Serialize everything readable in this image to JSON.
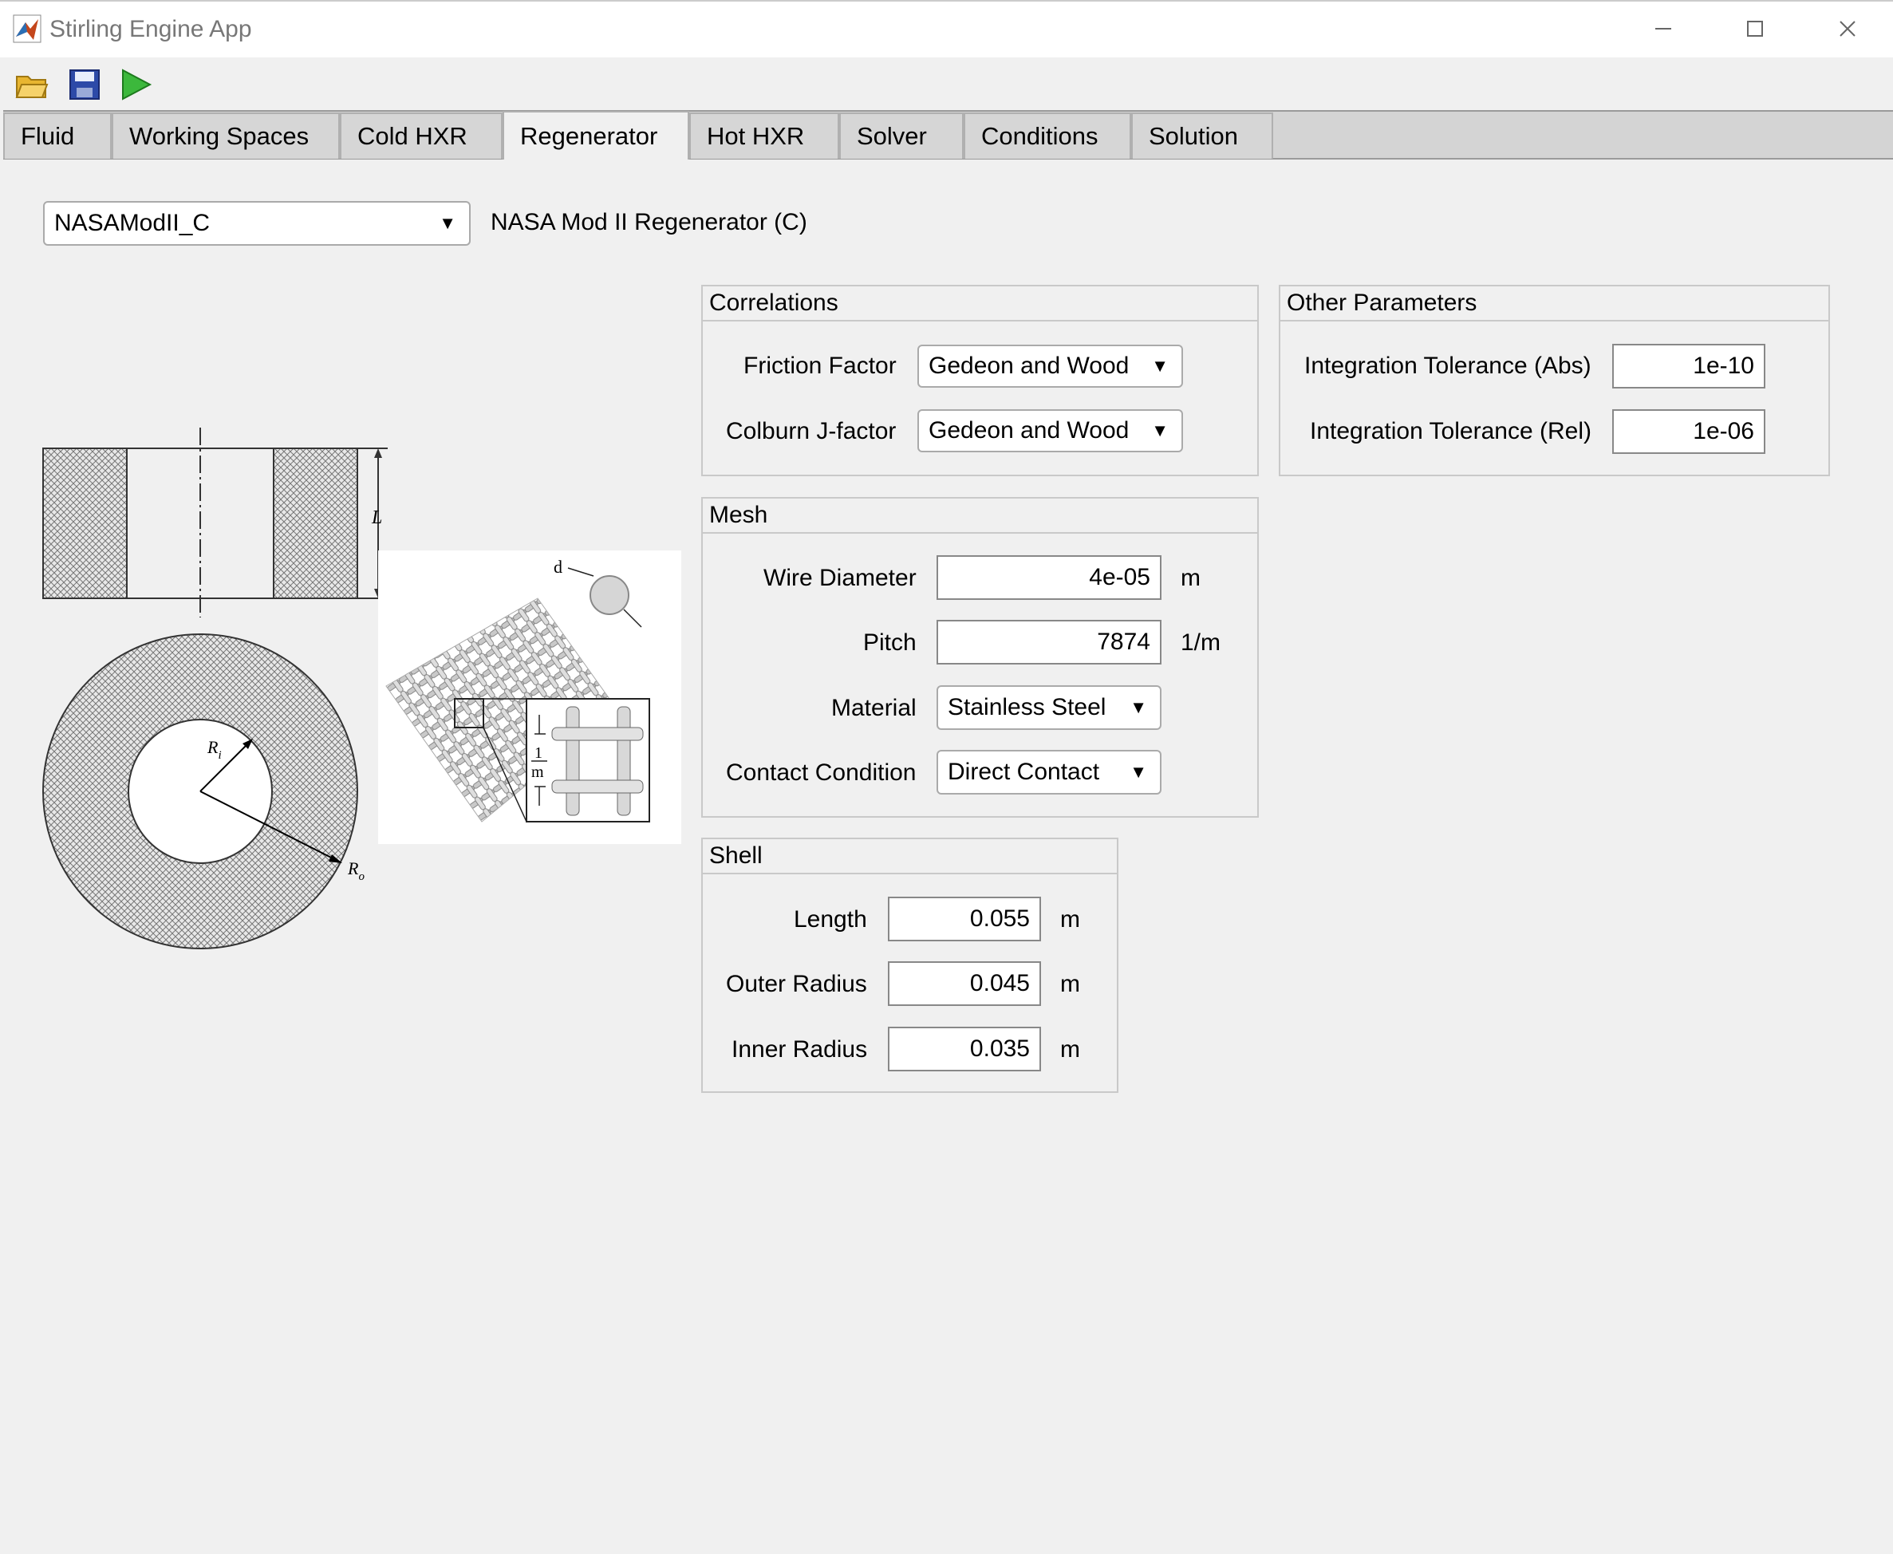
{
  "window": {
    "title": "Stirling Engine App"
  },
  "toolbar": {
    "open_icon": "folder-open-icon",
    "save_icon": "save-icon",
    "run_icon": "play-icon"
  },
  "tabs": [
    "Fluid",
    "Working Spaces",
    "Cold HXR",
    "Regenerator",
    "Hot HXR",
    "Solver",
    "Conditions",
    "Solution"
  ],
  "active_tab": "Regenerator",
  "selector": {
    "value": "NASAModII_C",
    "description": "NASA Mod II Regenerator (C)"
  },
  "diagram": {
    "length_label": "L",
    "inner_radius_label": "R",
    "inner_radius_sub": "i",
    "outer_radius_label": "R",
    "outer_radius_sub": "o",
    "mesh_d_label": "d",
    "mesh_pitch_num": "1",
    "mesh_pitch_den": "m"
  },
  "correlations": {
    "title": "Correlations",
    "friction_label": "Friction Factor",
    "friction_value": "Gedeon and Wood",
    "colburn_label": "Colburn J-factor",
    "colburn_value": "Gedeon and Wood"
  },
  "other": {
    "title": "Other Parameters",
    "abs_label": "Integration Tolerance (Abs)",
    "abs_value": "1e-10",
    "rel_label": "Integration Tolerance (Rel)",
    "rel_value": "1e-06"
  },
  "mesh": {
    "title": "Mesh",
    "wire_label": "Wire Diameter",
    "wire_value": "4e-05",
    "wire_unit": "m",
    "pitch_label": "Pitch",
    "pitch_value": "7874",
    "pitch_unit": "1/m",
    "material_label": "Material",
    "material_value": "Stainless Steel",
    "contact_label": "Contact Condition",
    "contact_value": "Direct Contact"
  },
  "shell": {
    "title": "Shell",
    "length_label": "Length",
    "length_value": "0.055",
    "length_unit": "m",
    "outer_label": "Outer Radius",
    "outer_value": "0.045",
    "outer_unit": "m",
    "inner_label": "Inner Radius",
    "inner_value": "0.035",
    "inner_unit": "m"
  }
}
